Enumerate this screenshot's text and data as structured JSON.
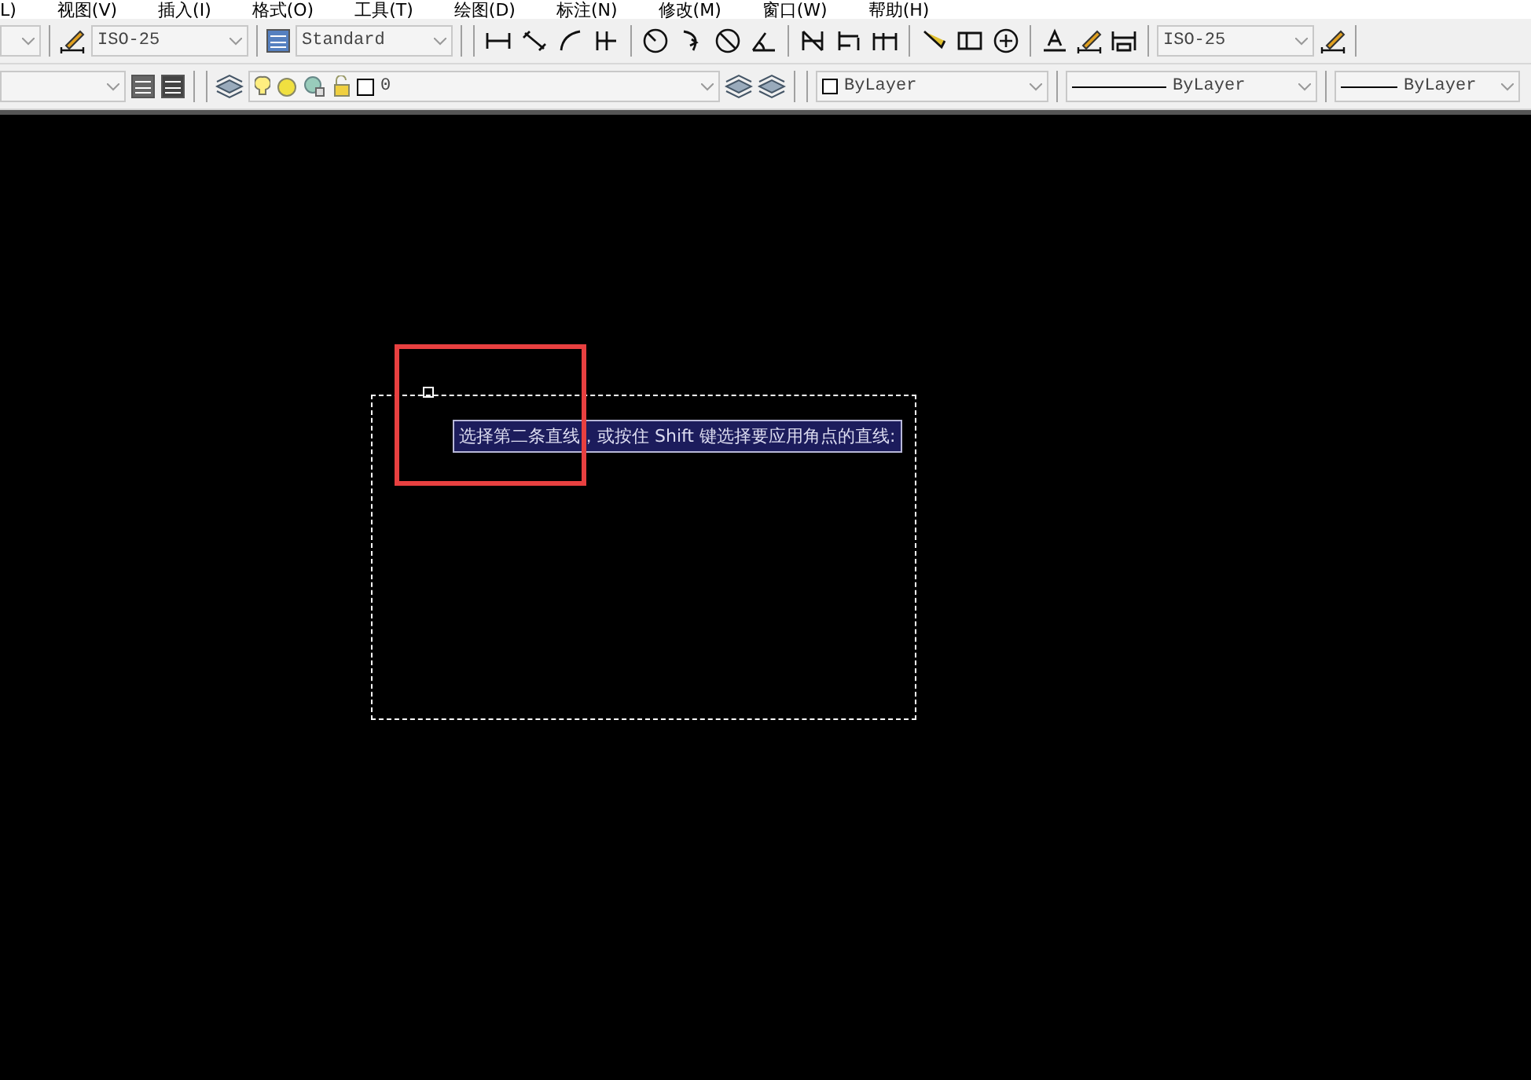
{
  "menu_bar": {
    "items": [
      "L)",
      "视图(V)",
      "插入(I)",
      "格式(O)",
      "工具(T)",
      "绘图(D)",
      "标注(N)",
      "修改(M)",
      "窗口(W)",
      "帮助(H)"
    ]
  },
  "toolbar_1": {
    "dim_style": "ISO-25",
    "text_style": "Standard",
    "dim_style_2": "ISO-25"
  },
  "toolbar_2": {
    "layer": "0",
    "color_setting": "ByLayer",
    "linetype": "ByLayer",
    "lineweight": "ByLayer"
  },
  "canvas": {
    "tooltip": "选择第二条直线，或按住 Shift 键选择要应用角点的直线:"
  }
}
